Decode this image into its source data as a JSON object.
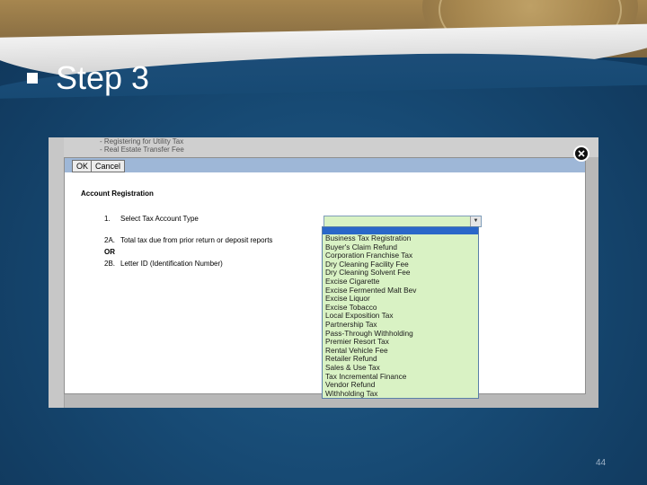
{
  "slide": {
    "title": "Step 3",
    "page_number": "44"
  },
  "background_page": {
    "lines": [
      "- Registering for Utility Tax",
      "- Real Estate Transfer Fee"
    ]
  },
  "dialog": {
    "ok_label": "OK",
    "cancel_label": "Cancel",
    "heading": "Account Registration",
    "rows": [
      {
        "num": "1.",
        "text": "Select Tax Account Type"
      },
      {
        "num": "2A.",
        "text": "Total tax due from prior return or deposit reports"
      },
      {
        "num": "OR",
        "text": ""
      },
      {
        "num": "2B.",
        "text": "Letter ID (Identification Number)"
      }
    ],
    "select_value": "",
    "options": [
      "Business Tax Registration",
      "Buyer's Claim Refund",
      "Corporation Franchise Tax",
      "Dry Cleaning Facility Fee",
      "Dry Cleaning Solvent Fee",
      "Excise Cigarette",
      "Excise Fermented Malt Bev",
      "Excise Liquor",
      "Excise Tobacco",
      "Local Exposition Tax",
      "Partnership Tax",
      "Pass-Through Withholding",
      "Premier Resort Tax",
      "Rental Vehicle Fee",
      "Retailer Refund",
      "Sales & Use Tax",
      "Tax Incremental Finance",
      "Vendor Refund",
      "Withholding Tax"
    ]
  },
  "colors": {
    "dropdown_bg": "#d9f2c4",
    "selected_highlight": "#2a67c9",
    "dialog_bar": "#9eb7d7"
  }
}
